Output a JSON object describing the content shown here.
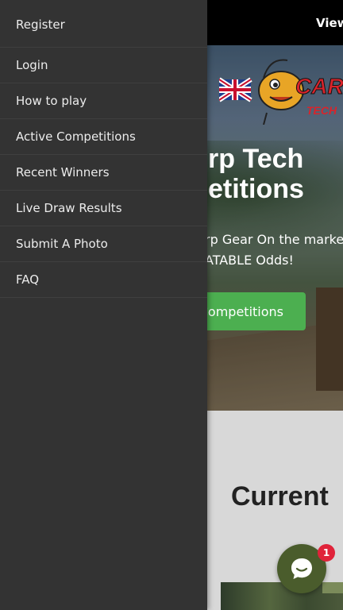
{
  "topbar": {
    "view_label": "View"
  },
  "hero": {
    "title_line1": "rp Tech",
    "title_line2": "etitions",
    "subtitle_line1": "rp Gear On the market",
    "subtitle_line2": "ATABLE Odds!",
    "cta_label": "Competitions"
  },
  "logo": {
    "text_carp": "CARP",
    "text_tech": "TECH"
  },
  "section": {
    "title": "Current"
  },
  "drawer": {
    "items": [
      {
        "label": "Register"
      },
      {
        "label": "Login"
      },
      {
        "label": "How to play"
      },
      {
        "label": "Active Competitions"
      },
      {
        "label": "Recent Winners"
      },
      {
        "label": "Live Draw Results"
      },
      {
        "label": "Submit A Photo"
      },
      {
        "label": "FAQ"
      }
    ]
  },
  "chat": {
    "badge_count": "1",
    "icon": "chat-bubble-icon"
  },
  "colors": {
    "drawer_bg": "#333333",
    "cta_green": "#4caf50",
    "chat_bg": "#4a5c2c",
    "badge_red": "#e0233a"
  }
}
